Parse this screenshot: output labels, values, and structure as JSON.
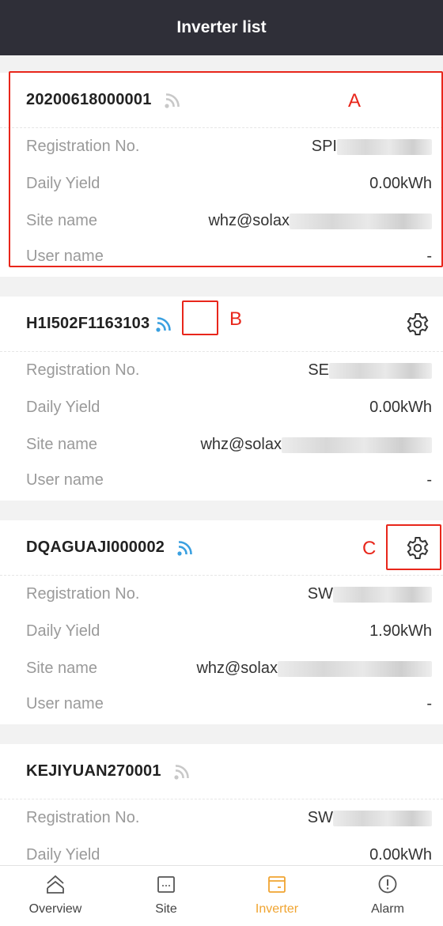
{
  "header": {
    "title": "Inverter list"
  },
  "colors": {
    "header_bg": "#2f2f38",
    "accent": "#f0a431",
    "wifi_online": "#3aa0e0",
    "wifi_offline": "#c8c8c8",
    "annotation": "#e8261b"
  },
  "labels": {
    "registration": "Registration No.",
    "daily_yield": "Daily Yield",
    "site_name": "Site name",
    "user_name": "User name"
  },
  "inverters": [
    {
      "serial": "20200618000001",
      "wifi_status": "offline",
      "registration_prefix": "SPI",
      "daily_yield": "0.00kWh",
      "site_name_prefix": "whz@solax",
      "user_name": "-",
      "has_settings": false
    },
    {
      "serial": "H1I502F1163103",
      "wifi_status": "online",
      "registration_prefix": "SE",
      "daily_yield": "0.00kWh",
      "site_name_prefix": "whz@solax",
      "user_name": "-",
      "has_settings": true
    },
    {
      "serial": "DQAGUAJI000002",
      "wifi_status": "online",
      "registration_prefix": "SW",
      "daily_yield": "1.90kWh",
      "site_name_prefix": "whz@solax",
      "user_name": "-",
      "has_settings": true
    },
    {
      "serial": "KEJIYUAN270001",
      "wifi_status": "offline",
      "registration_prefix": "SW",
      "daily_yield": "0.00kWh"
    }
  ],
  "annotations": {
    "a": "A",
    "b": "B",
    "c": "C"
  },
  "tabbar": {
    "tabs": [
      {
        "label": "Overview",
        "icon": "home-icon"
      },
      {
        "label": "Site",
        "icon": "site-icon"
      },
      {
        "label": "Inverter",
        "icon": "inverter-icon",
        "active": true
      },
      {
        "label": "Alarm",
        "icon": "alarm-icon"
      }
    ]
  }
}
